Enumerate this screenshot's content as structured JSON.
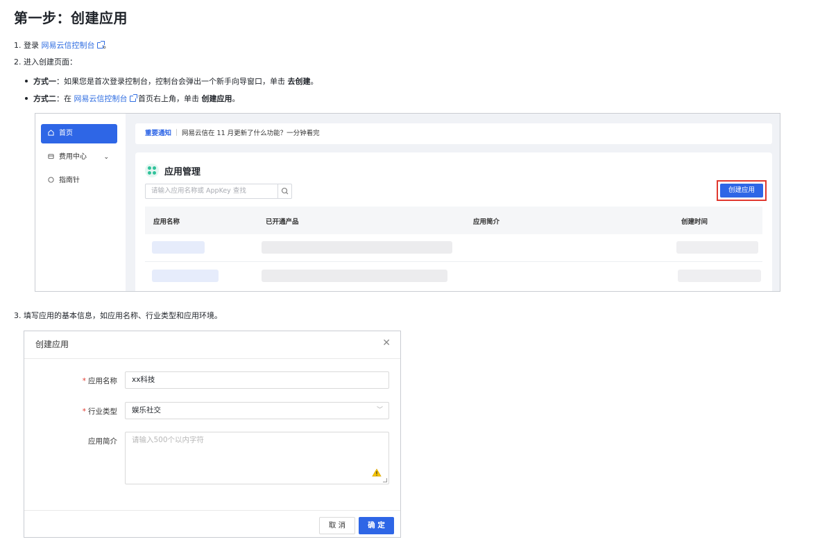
{
  "title": "第一步：创建应用",
  "step1": {
    "num": "1. 登录 ",
    "link": "网易云信控制台",
    "end": "。"
  },
  "step2": {
    "text": "2. 进入创建页面："
  },
  "bullet1": {
    "label": "方式一",
    "text": "：如果您是首次登录控制台，控制台会弹出一个新手向导窗口，单击 ",
    "action": "去创建",
    "end": "。"
  },
  "bullet2": {
    "label": "方式二",
    "pre": "：在 ",
    "link": "网易云信控制台",
    "mid": " 首页右上角，单击 ",
    "action": "创建应用",
    "end": "。"
  },
  "console": {
    "sidebar": [
      {
        "label": "首页",
        "icon": "home-icon"
      },
      {
        "label": "费用中心",
        "icon": "wallet-icon"
      },
      {
        "label": "指南针",
        "icon": "compass-icon"
      }
    ],
    "notice_tag": "重要通知",
    "notice_text": "网易云信在 11 月更新了什么功能？一分钟看完",
    "panel_title": "应用管理",
    "search_placeholder": "请输入应用名称或 AppKey 查找",
    "create_button": "创建应用",
    "columns": [
      "应用名称",
      "已开通产品",
      "应用简介",
      "创建时间"
    ]
  },
  "step3": {
    "text": "3. 填写应用的基本信息，如应用名称、行业类型和应用环境。"
  },
  "dialog": {
    "title": "创建应用",
    "name_label": "应用名称",
    "name_value": "xx科技",
    "industry_label": "行业类型",
    "industry_value": "娱乐社交",
    "intro_label": "应用简介",
    "intro_placeholder": "请输入500个以内字符",
    "cancel": "取 消",
    "ok": "确 定"
  },
  "colors": {
    "accent": "#2e66e6",
    "link": "#2f6de1",
    "highlight": "#e0382e"
  }
}
